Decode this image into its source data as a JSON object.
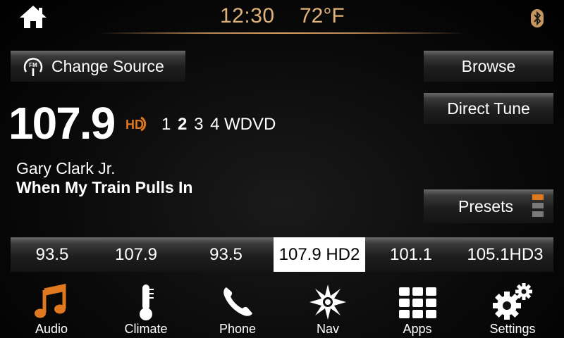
{
  "status": {
    "time": "12:30",
    "temperature": "72°F"
  },
  "colors": {
    "accent": "#e0781f",
    "status_text": "#e0b27a"
  },
  "source_button": {
    "label": "Change Source",
    "icon": "fm-radio-icon"
  },
  "right_buttons": {
    "browse": "Browse",
    "direct_tune": "Direct Tune",
    "presets": "Presets"
  },
  "station": {
    "frequency": "107.9",
    "hd_channels": [
      "1",
      "2",
      "3",
      "4"
    ],
    "active_channel": "2",
    "call_sign": "WDVD",
    "artist": "Gary Clark Jr.",
    "song": "When My Train Pulls In"
  },
  "presets": [
    {
      "label": "93.5",
      "selected": false
    },
    {
      "label": "107.9",
      "selected": false
    },
    {
      "label": "93.5",
      "selected": false
    },
    {
      "label": "107.9 HD2",
      "selected": true
    },
    {
      "label": "101.1",
      "selected": false
    },
    {
      "label": "105.1HD3",
      "selected": false
    }
  ],
  "dock": [
    {
      "label": "Audio",
      "icon": "music-note-icon",
      "active": true
    },
    {
      "label": "Climate",
      "icon": "thermometer-icon",
      "active": false
    },
    {
      "label": "Phone",
      "icon": "phone-icon",
      "active": false
    },
    {
      "label": "Nav",
      "icon": "compass-icon",
      "active": false
    },
    {
      "label": "Apps",
      "icon": "apps-grid-icon",
      "active": false
    },
    {
      "label": "Settings",
      "icon": "gear-icon",
      "active": false
    }
  ]
}
